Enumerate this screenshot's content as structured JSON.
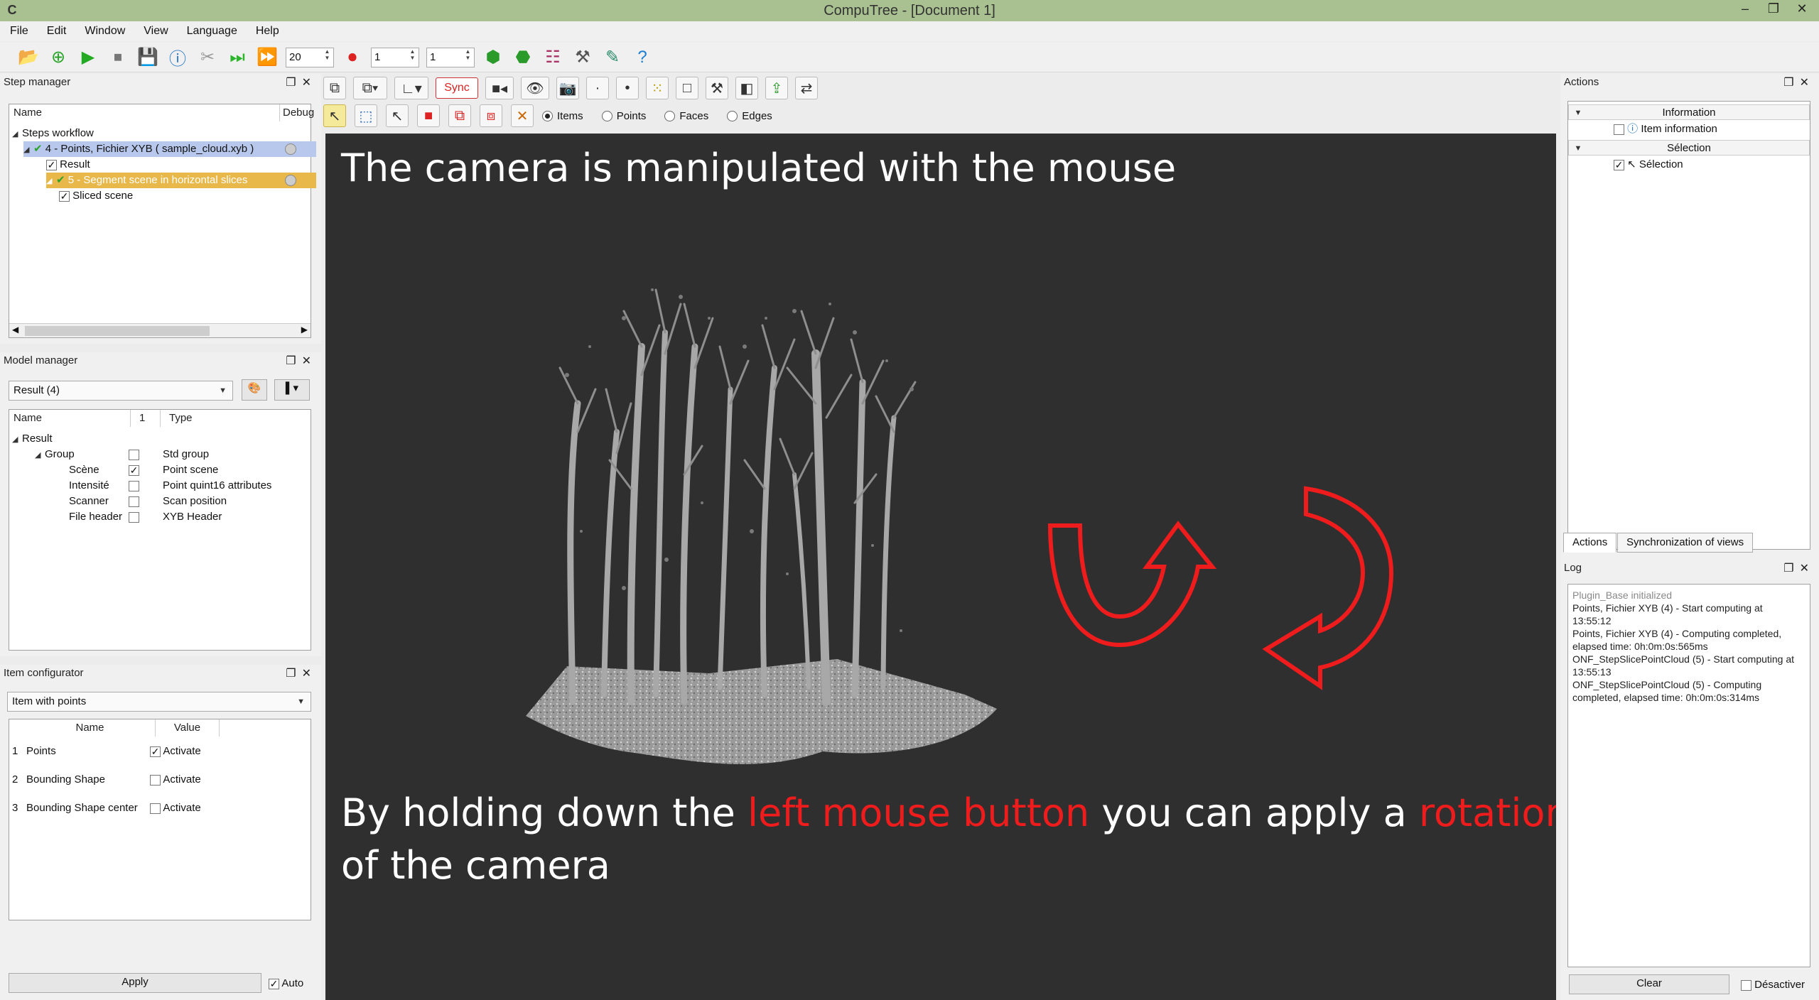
{
  "window": {
    "title": "CompuTree - [Document 1]",
    "app_icon": "computree-logo-icon"
  },
  "menu": [
    "File",
    "Edit",
    "Window",
    "View",
    "Language",
    "Help"
  ],
  "toolbar": {
    "step_spin_1": "20",
    "spin_2": "1",
    "spin_3": "1"
  },
  "step_manager": {
    "title": "Step manager",
    "columns": [
      "Name",
      "Debug"
    ],
    "tree": [
      {
        "label": "Steps workflow",
        "level": 0
      },
      {
        "label": "4 - Points, Fichier XYB ( sample_cloud.xyb )",
        "level": 1
      },
      {
        "label": "Result",
        "level": 2
      },
      {
        "label": "5 - Segment scene in horizontal slices",
        "level": 2
      },
      {
        "label": "Sliced scene",
        "level": 3
      }
    ]
  },
  "model_manager": {
    "title": "Model manager",
    "result_combo": "Result (4)",
    "columns": [
      "Name",
      "1",
      "Type"
    ],
    "rows": [
      {
        "name": "Result",
        "checked": null,
        "type": ""
      },
      {
        "name": "Group",
        "checked": false,
        "type": "Std group"
      },
      {
        "name": "Scène",
        "checked": true,
        "type": "Point scene"
      },
      {
        "name": "Intensité",
        "checked": false,
        "type": "Point quint16 attributes"
      },
      {
        "name": "Scanner",
        "checked": false,
        "type": "Scan position"
      },
      {
        "name": "File header",
        "checked": false,
        "type": "XYB Header"
      }
    ]
  },
  "item_configurator": {
    "title": "Item configurator",
    "combo": "Item with points",
    "columns": [
      "Name",
      "Value"
    ],
    "rows": [
      {
        "num": "1",
        "name": "Points",
        "checked": true,
        "value": "Activate"
      },
      {
        "num": "2",
        "name": "Bounding Shape",
        "checked": false,
        "value": "Activate"
      },
      {
        "num": "3",
        "name": "Bounding Shape center",
        "checked": false,
        "value": "Activate"
      }
    ],
    "apply_label": "Apply",
    "auto_label": "Auto"
  },
  "view_toolbar": {
    "sync_label": "Sync",
    "select_modes": [
      "Items",
      "Points",
      "Faces",
      "Edges"
    ],
    "selected_mode": "Items"
  },
  "viewport": {
    "caption_top": "The camera is manipulated with the mouse",
    "caption_bottom": {
      "part1": "By holding down the ",
      "red1": "left mouse button",
      "part2": " you can apply a ",
      "red2": "rotation",
      "line2": "of the camera"
    },
    "arrow_color": "#ee1c1c"
  },
  "actions": {
    "title": "Actions",
    "groups": [
      {
        "label": "Information",
        "items": [
          "Item information"
        ]
      },
      {
        "label": "Sélection",
        "items": [
          "Sélection"
        ]
      }
    ],
    "tabs": [
      "Actions",
      "Synchronization of views"
    ]
  },
  "log": {
    "title": "Log",
    "lines": [
      "Plugin_Base initialized",
      "Points, Fichier XYB (4) - Start computing at",
      "13:55:12",
      "Points, Fichier XYB (4) - Computing completed,",
      "elapsed time: 0h:0m:0s:565ms",
      "ONF_StepSlicePointCloud (5) - Start computing at",
      "13:55:13",
      "ONF_StepSlicePointCloud (5) - Computing",
      "completed, elapsed time: 0h:0m:0s:314ms"
    ],
    "clear_label": "Clear",
    "disable_label": "Désactiver"
  },
  "colors": {
    "titlebar": "#a9c190",
    "viewport_bg": "#2f2f2f",
    "highlight_red": "#ee1c1c",
    "step_selected": "#b8c8ec",
    "step_running": "#e8b84a"
  }
}
